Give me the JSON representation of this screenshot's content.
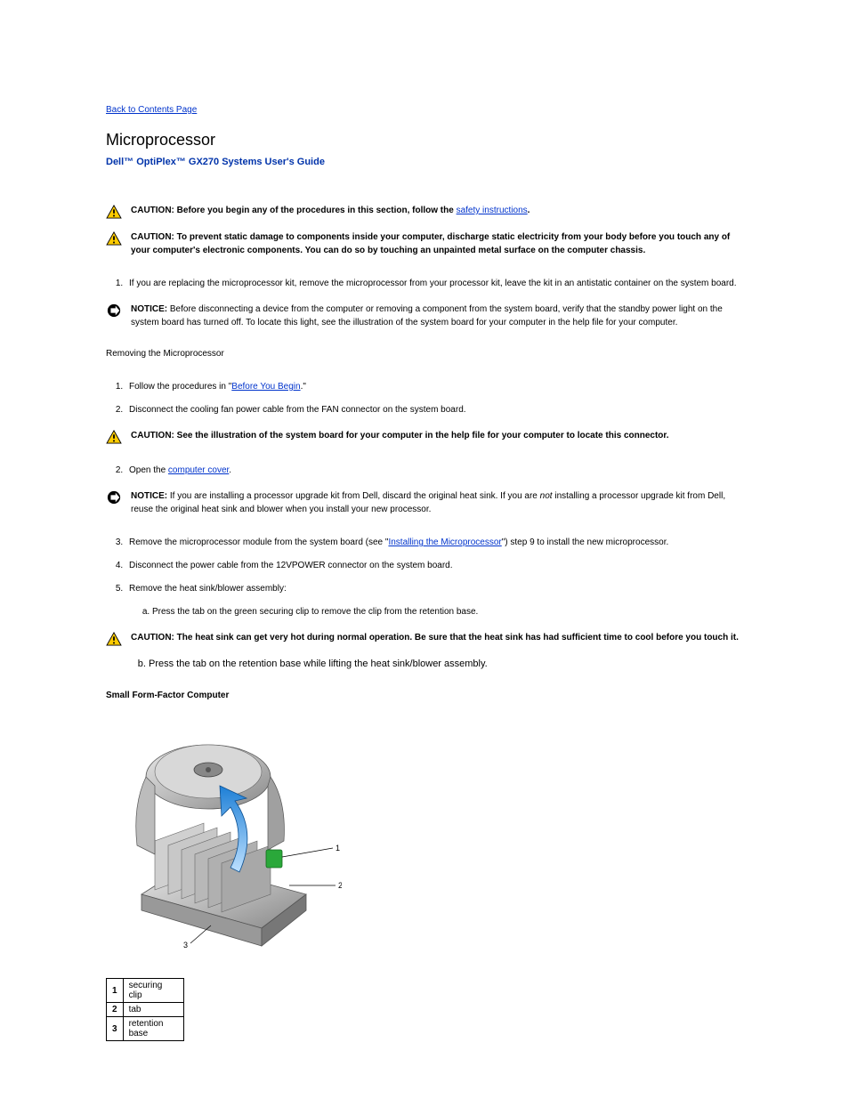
{
  "back": {
    "label": "Back to Contents Page"
  },
  "title": "Microprocessor",
  "subtitle": "Dell™ OptiPlex™ GX270 Systems User's Guide",
  "caution1": {
    "strong": "CAUTION: Before you begin any of the procedures in this section, follow the ",
    "link": "safety instructions",
    "after": "."
  },
  "caution2": {
    "strong": "CAUTION: To prevent static damage to components inside your computer, discharge static electricity from your body before you touch any of your computer's electronic components. You can do so by touching an unpainted metal surface on the computer chassis."
  },
  "notice1": {
    "strong": "NOTICE:",
    "text": " Before disconnecting a device from the computer or removing a component from the system board, verify that the standby power light on the system board has turned off. To locate this light, see the illustration of the system board for your computer in the help file for your computer."
  },
  "steps_before": [
    "Follow the procedures in \"",
    "Before You Begin",
    ".\"",
    "Disconnect the cooling fan power cable from the FAN connector on the system board."
  ],
  "step2": "Disconnect the power cable from the 12VPOWER connector on the system board.",
  "step3": "Remove the heat sink/blower assembly:",
  "caution3": {
    "strong": "CAUTION: See the illustration of the system board for your computer in the help file for your computer to locate this connector."
  },
  "step5_lead": "Open the ",
  "step5_link": "computer cover",
  "step5_after": ".",
  "notice2": {
    "strong": "NOTICE:",
    "before": " If you are installing a processor upgrade kit from Dell, discard the original heat sink. If you are ",
    "italic": "not",
    "after": " installing a processor upgrade kit from Dell, reuse the original heat sink and blower when you install your new processor."
  },
  "step6_before": "Remove the microprocessor module from the system board (see \"",
  "step6_link": "Installing the Microprocessor",
  "step6_after": "\") step 9 to install the new microprocessor.",
  "sub_a": "Press the tab on the green securing clip to remove the clip from the retention base.",
  "caution4": {
    "strong": "CAUTION: The heat sink can get very hot during normal operation. Be sure that the heat sink has had sufficient time to cool before you touch it."
  },
  "sub_b": "Press the tab on the retention base while lifting the heat sink/blower assembly.",
  "section_label": "Small Form-Factor Computer",
  "table": {
    "r1": {
      "n": "1",
      "t": "securing clip"
    },
    "r2": {
      "n": "2",
      "t": "tab"
    },
    "r3": {
      "n": "3",
      "t": "retention base"
    }
  }
}
